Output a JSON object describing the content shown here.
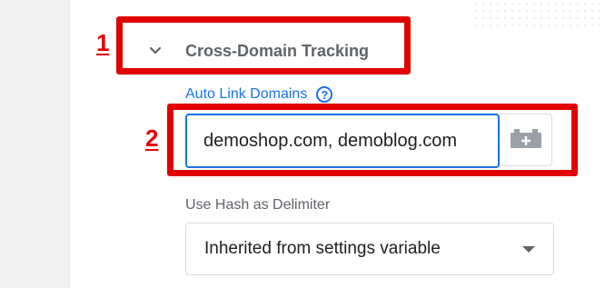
{
  "annotations": {
    "step1": "1",
    "step2": "2",
    "color": "#e00000"
  },
  "section": {
    "title": "Cross-Domain Tracking",
    "icon": "chevron-down-icon"
  },
  "auto_link": {
    "label": "Auto Link Domains",
    "help_icon": "?",
    "value": "demoshop.com, demoblog.com",
    "variable_button_icon": "variable-picker-icon"
  },
  "hash_delimiter": {
    "label": "Use Hash as Delimiter",
    "selected": "Inherited from settings variable"
  },
  "colors": {
    "accent": "#1a73e8",
    "muted_text": "#5f6368"
  }
}
